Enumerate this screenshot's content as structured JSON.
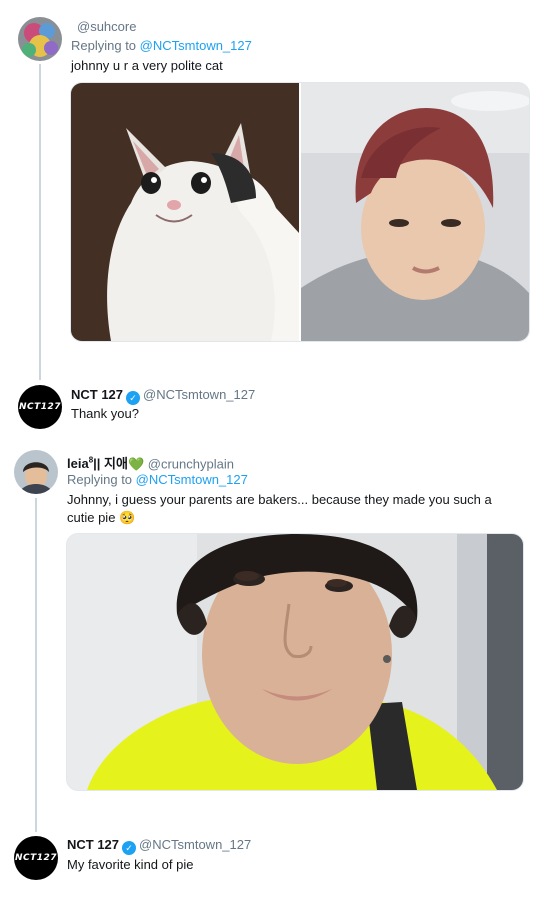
{
  "tweets": [
    {
      "handle": "@suhcore",
      "replying_prefix": "Replying to",
      "replying_handle": "@NCTsmtown_127",
      "text": "johnny u r a very polite cat"
    },
    {
      "name": "NCT 127",
      "avatar_text": "NCT127",
      "handle": "@NCTsmtown_127",
      "text": "Thank you?"
    },
    {
      "name": "leia",
      "name_sup": "8",
      "name_suffix": "|| 지애",
      "heart_emoji": "💚",
      "handle": "@crunchyplain",
      "replying_prefix": "Replying to",
      "replying_handle": "@NCTsmtown_127",
      "text_line1": "Johnny, i guess your parents are bakers... because they made you such a",
      "text_line2": "cutie pie",
      "emoji": "🥺"
    },
    {
      "name": "NCT 127",
      "avatar_text": "NCT127",
      "handle": "@NCTsmtown_127",
      "text": "My favorite kind of pie"
    }
  ],
  "icons": {
    "verified": "verified-badge-icon",
    "verified_glyph": "✓"
  },
  "colors": {
    "link": "#1da1f2",
    "muted": "#657786",
    "thread_line": "#ccd6dd"
  }
}
